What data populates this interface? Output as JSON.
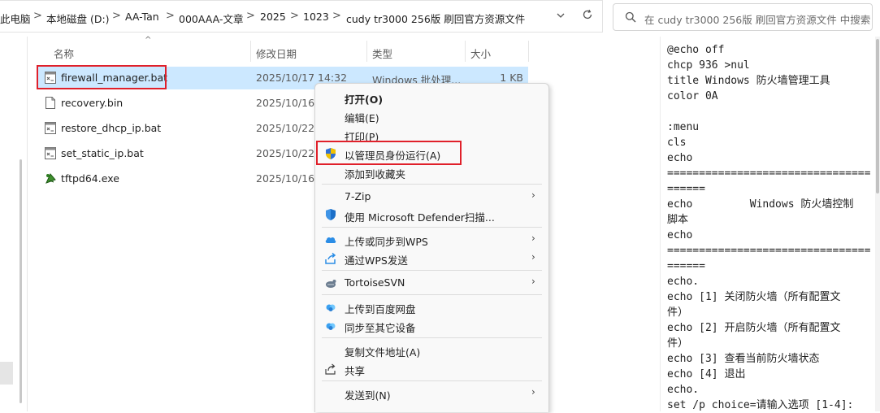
{
  "address_bar": {
    "crumbs": [
      "此电脑",
      "本地磁盘 (D:)",
      "AA-Tan",
      "000AAA-文章",
      "2025",
      "1023",
      "cudy tr3000 256版 刷回官方资源文件"
    ],
    "separator": ">",
    "dropdown_icon": "chevron-down-icon",
    "refresh_icon": "refresh-icon"
  },
  "search": {
    "placeholder": "在 cudy tr3000 256版 刷回官方资源文件 中搜索",
    "icon": "search-icon"
  },
  "columns": {
    "name": "名称",
    "date": "修改日期",
    "type": "类型",
    "size": "大小"
  },
  "files": [
    {
      "name": "firewall_manager.bat",
      "date": "2025/10/17 14:32",
      "type": "Windows 批处理...",
      "size": "1 KB",
      "icon": "batch-file-icon",
      "selected": true
    },
    {
      "name": "recovery.bin",
      "date": "2025/10/16",
      "type": "",
      "size": "",
      "icon": "file-icon",
      "selected": false
    },
    {
      "name": "restore_dhcp_ip.bat",
      "date": "2025/10/22",
      "type": "",
      "size": "",
      "icon": "batch-file-icon",
      "selected": false
    },
    {
      "name": "set_static_ip.bat",
      "date": "2025/10/22",
      "type": "",
      "size": "",
      "icon": "batch-file-icon",
      "selected": false
    },
    {
      "name": "tftpd64.exe",
      "date": "2025/10/16",
      "type": "",
      "size": "",
      "icon": "exe-icon",
      "selected": false
    }
  ],
  "context_menu": {
    "items": [
      {
        "label": "打开(O)",
        "bold": true,
        "icon": ""
      },
      {
        "label": "编辑(E)",
        "icon": ""
      },
      {
        "label": "打印(P)",
        "icon": ""
      },
      {
        "label": "以管理员身份运行(A)",
        "icon": "uac-shield-icon"
      },
      {
        "label": "添加到收藏夹",
        "icon": ""
      },
      {
        "label": "7-Zip",
        "icon": "",
        "submenu": true
      },
      {
        "label": "使用 Microsoft Defender扫描...",
        "icon": "defender-shield-icon"
      },
      {
        "label": "上传或同步到WPS",
        "icon": "wps-cloud-icon",
        "submenu": true
      },
      {
        "label": "通过WPS发送",
        "icon": "wps-send-icon",
        "submenu": true
      },
      {
        "label": "TortoiseSVN",
        "icon": "tortoisesvn-icon",
        "submenu": true
      },
      {
        "label": "上传到百度网盘",
        "icon": "baidu-netdisk-icon"
      },
      {
        "label": "同步至其它设备",
        "icon": "baidu-sync-icon"
      },
      {
        "label": "复制文件地址(A)",
        "icon": ""
      },
      {
        "label": "共享",
        "icon": "share-icon"
      },
      {
        "label": "发送到(N)",
        "icon": "",
        "submenu": true
      }
    ]
  },
  "preview": {
    "lines": [
      "@echo off",
      "chcp 936 >nul",
      "title Windows 防火墙管理工具",
      "color 0A",
      "",
      ":menu",
      "cls",
      "echo",
      "================================",
      "======",
      "echo         Windows 防火墙控制",
      "脚本",
      "echo",
      "================================",
      "======",
      "echo.",
      "echo [1] 关闭防火墙（所有配置文",
      "件）",
      "echo [2] 开启防火墙（所有配置文",
      "件）",
      "echo [3] 查看当前防火墙状态",
      "echo [4] 退出",
      "echo.",
      "set /p choice=请输入选项 [1-4]:"
    ]
  },
  "colors": {
    "selection": "#cce8ff",
    "highlight_box": "#e0202a"
  }
}
